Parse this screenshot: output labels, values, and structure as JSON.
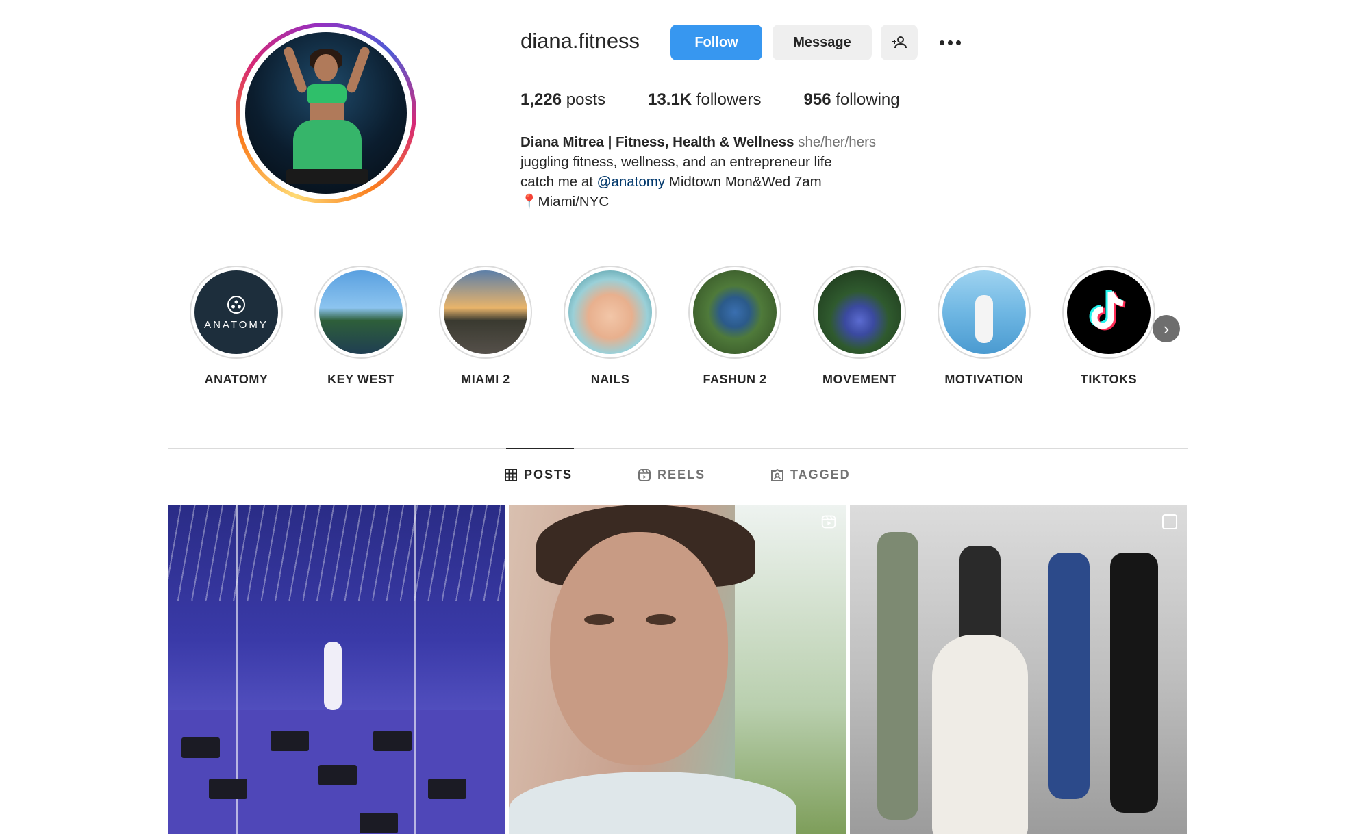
{
  "profile": {
    "username": "diana.fitness",
    "follow_label": "Follow",
    "message_label": "Message",
    "add_user_icon": "person-add-icon",
    "more_icon": "more-icon",
    "accent_color": "#3797f0"
  },
  "stats": {
    "posts_count": "1,226",
    "posts_label": " posts",
    "followers_count": "13.1K",
    "followers_label": " followers",
    "following_count": "956",
    "following_label": " following"
  },
  "bio": {
    "name": "Diana Mitrea | Fitness, Health & Wellness",
    "pronouns": " she/her/hers",
    "line1": "juggling fitness, wellness, and an entrepreneur life",
    "line2_prefix": "catch me at ",
    "line2_mention": "@anatomy",
    "line2_suffix": " Midtown Mon&Wed 7am",
    "line3": "Miami/NYC"
  },
  "highlights": [
    {
      "label": "ANATOMY"
    },
    {
      "label": "KEY WEST"
    },
    {
      "label": "MIAMI 2"
    },
    {
      "label": "NAILS"
    },
    {
      "label": "FASHUN 2"
    },
    {
      "label": "MOVEMENT"
    },
    {
      "label": "MOTIVATION"
    },
    {
      "label": "TIKTOKS"
    }
  ],
  "highlight_anatomy_logo_text": "ANATOMY",
  "tabs": {
    "posts": "POSTS",
    "reels": "REELS",
    "tagged": "TAGGED"
  }
}
